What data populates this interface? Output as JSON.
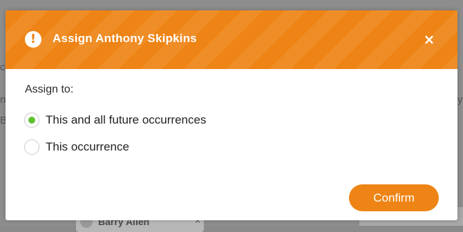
{
  "background": {
    "fragment_left_1": "c",
    "fragment_left_2": "n",
    "fragment_left_3": "B",
    "fragment_right": "y",
    "chip_name": "Barry Allen",
    "chip_close_icon": "close-icon"
  },
  "modal": {
    "title": "Assign Anthony Skipkins",
    "header_icon": "exclamation-circle-icon",
    "header_color": "#ee8415",
    "close_label": "×",
    "close_icon": "close-icon",
    "assign_label": "Assign to:",
    "options": [
      {
        "label": "This and all future occurrences",
        "selected": true
      },
      {
        "label": "This occurrence",
        "selected": false
      }
    ],
    "selected_color": "#5ec12f",
    "confirm_label": "Confirm"
  }
}
